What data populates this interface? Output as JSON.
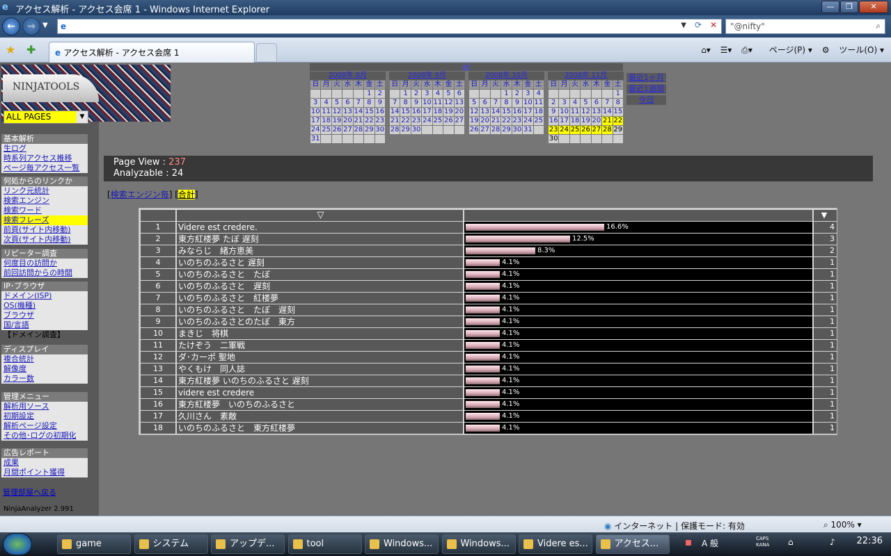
{
  "window": {
    "title": "アクセス解析 - アクセス会席 1 - Windows Internet Explorer"
  },
  "ie_icon": "ie-logo-icon",
  "address": {
    "url": "",
    "search_placeholder": "\"@nifty\""
  },
  "tab": {
    "title": "アクセス解析 - アクセス会席 1"
  },
  "cmd": {
    "page": "ページ(P)",
    "tools": "ツール(O)"
  },
  "logo": {
    "text": "NINJATOOLS"
  },
  "page_select": {
    "value": "ALL PAGES"
  },
  "sidebar": [
    {
      "header": "基本解析",
      "items": [
        {
          "label": "生ログ"
        },
        {
          "label": "時系列アクセス推移"
        },
        {
          "label": "ページ毎アクセス一覧"
        }
      ]
    },
    {
      "header": "何処からのリンクか",
      "items": [
        {
          "label": "リンク元統計"
        },
        {
          "label": "検索エンジン"
        },
        {
          "label": "検索ワード"
        },
        {
          "label": "検索フレーズ",
          "selected": true
        },
        {
          "label": "前頁(サイト内移動)"
        },
        {
          "label": "次頁(サイト内移動)"
        }
      ]
    },
    {
      "header": "リピーター調査",
      "items": [
        {
          "label": "何度目の訪問か"
        },
        {
          "label": "前回訪問からの時間"
        }
      ]
    },
    {
      "header": "IP･ブラウザ",
      "items": [
        {
          "label": "ドメイン(ISP)"
        },
        {
          "label": "OS(機種)"
        },
        {
          "label": "ブラウザ"
        },
        {
          "label": "国/言語"
        },
        {
          "label": "【ドメイン調査】",
          "plain": true
        }
      ]
    },
    {
      "header": "ディスプレイ",
      "items": [
        {
          "label": "複合統計"
        },
        {
          "label": "解像度"
        },
        {
          "label": "カラー数"
        }
      ]
    },
    {
      "header": "管理メニュー",
      "items": [
        {
          "label": "解析用ソース"
        },
        {
          "label": "初期設定"
        },
        {
          "label": "解析ページ設定"
        },
        {
          "label": "その他･ログの初期化"
        }
      ]
    },
    {
      "header": "広告レポート",
      "items": [
        {
          "label": "成果"
        },
        {
          "label": "月間ポイント獲得"
        }
      ]
    }
  ],
  "admin_link": "管理部屋へ戻る",
  "version": "NinjaAnalyzer 2.991",
  "calendar": {
    "all_label": "all",
    "weekdays": [
      "日",
      "月",
      "火",
      "水",
      "木",
      "金",
      "土"
    ],
    "months": [
      {
        "label": "2008年 8月",
        "weeks": [
          [
            "",
            "",
            "",
            "",
            "",
            "1",
            "2"
          ],
          [
            "3",
            "4",
            "5",
            "6",
            "7",
            "8",
            "9"
          ],
          [
            "10",
            "11",
            "12",
            "13",
            "14",
            "15",
            "16"
          ],
          [
            "17",
            "18",
            "19",
            "20",
            "21",
            "22",
            "23"
          ],
          [
            "24",
            "25",
            "26",
            "27",
            "28",
            "29",
            "30"
          ],
          [
            "31",
            "",
            "",
            "",
            "",
            "",
            ""
          ]
        ]
      },
      {
        "label": "2008年 9月",
        "weeks": [
          [
            "",
            "1",
            "2",
            "3",
            "4",
            "5",
            "6"
          ],
          [
            "7",
            "8",
            "9",
            "10",
            "11",
            "12",
            "13"
          ],
          [
            "14",
            "15",
            "16",
            "17",
            "18",
            "19",
            "20"
          ],
          [
            "21",
            "22",
            "23",
            "24",
            "25",
            "26",
            "27"
          ],
          [
            "28",
            "29",
            "30",
            "",
            "",
            "",
            ""
          ]
        ]
      },
      {
        "label": "2008年 10月",
        "weeks": [
          [
            "",
            "",
            "",
            "1",
            "2",
            "3",
            "4"
          ],
          [
            "5",
            "6",
            "7",
            "8",
            "9",
            "10",
            "11"
          ],
          [
            "12",
            "13",
            "14",
            "15",
            "16",
            "17",
            "18"
          ],
          [
            "19",
            "20",
            "21",
            "22",
            "23",
            "24",
            "25"
          ],
          [
            "26",
            "27",
            "28",
            "29",
            "30",
            "31",
            ""
          ]
        ]
      },
      {
        "label": "2008年 11月",
        "weeks": [
          [
            "",
            "",
            "",
            "",
            "",
            "",
            "1"
          ],
          [
            "2",
            "3",
            "4",
            "5",
            "6",
            "7",
            "8"
          ],
          [
            "9",
            "10",
            "11",
            "12",
            "13",
            "14",
            "15"
          ],
          [
            "16",
            "17",
            "18",
            "19",
            "20",
            "21",
            "22"
          ],
          [
            "23",
            "24",
            "25",
            "26",
            "27",
            "28",
            "29"
          ],
          [
            "30",
            "",
            "",
            "",
            "",
            "",
            ""
          ]
        ]
      }
    ],
    "highlight_november": [
      "21",
      "22",
      "23",
      "24",
      "25",
      "26",
      "27",
      "28"
    ],
    "range_buttons": [
      "最近1ヶ月",
      "最近1週間",
      "今日"
    ]
  },
  "summary": {
    "page_view_label": "Page View : ",
    "page_view_value": "237",
    "analyzable_label": "Analyzable : ",
    "analyzable_value": "24"
  },
  "subtabs": {
    "left_bracket": "[",
    "engine": "検索エンジン毎",
    "mid": "] [",
    "total": "合計",
    "right_bracket": "]"
  },
  "table": {
    "header_term": "▽",
    "header_count": "▼",
    "rows": [
      {
        "n": "1",
        "term": "Videre est credere.",
        "pct": "16.6%",
        "ratio": 0.166,
        "count": "4"
      },
      {
        "n": "2",
        "term": "東方紅楼夢 たぼ 遅刻",
        "pct": "12.5%",
        "ratio": 0.125,
        "count": "3"
      },
      {
        "n": "3",
        "term": "みならじ　緒方恵美",
        "pct": "8.3%",
        "ratio": 0.083,
        "count": "2"
      },
      {
        "n": "4",
        "term": "いのちのふるさと 遅刻",
        "pct": "4.1%",
        "ratio": 0.041,
        "count": "1"
      },
      {
        "n": "5",
        "term": "いのちのふるさと　たぼ",
        "pct": "4.1%",
        "ratio": 0.041,
        "count": "1"
      },
      {
        "n": "6",
        "term": "いのちのふるさと　遅刻",
        "pct": "4.1%",
        "ratio": 0.041,
        "count": "1"
      },
      {
        "n": "7",
        "term": "いのちのふるさと　紅楼夢",
        "pct": "4.1%",
        "ratio": 0.041,
        "count": "1"
      },
      {
        "n": "8",
        "term": "いのちのふるさと　たぼ　遅刻",
        "pct": "4.1%",
        "ratio": 0.041,
        "count": "1"
      },
      {
        "n": "9",
        "term": "いのちのふるさとのたぼ　東方",
        "pct": "4.1%",
        "ratio": 0.041,
        "count": "1"
      },
      {
        "n": "10",
        "term": "まきじ　将棋",
        "pct": "4.1%",
        "ratio": 0.041,
        "count": "1"
      },
      {
        "n": "11",
        "term": "たけぞう　二軍戦",
        "pct": "4.1%",
        "ratio": 0.041,
        "count": "1"
      },
      {
        "n": "12",
        "term": "ダ･カーポ 聖地",
        "pct": "4.1%",
        "ratio": 0.041,
        "count": "1"
      },
      {
        "n": "13",
        "term": "やくもけ　同人誌",
        "pct": "4.1%",
        "ratio": 0.041,
        "count": "1"
      },
      {
        "n": "14",
        "term": "東方紅楼夢 いのちのふるさと 遅刻",
        "pct": "4.1%",
        "ratio": 0.041,
        "count": "1"
      },
      {
        "n": "15",
        "term": "videre est credere",
        "pct": "4.1%",
        "ratio": 0.041,
        "count": "1"
      },
      {
        "n": "16",
        "term": "東方紅楼夢　いのちのふるさと",
        "pct": "4.1%",
        "ratio": 0.041,
        "count": "1"
      },
      {
        "n": "17",
        "term": "久川さん　素敵",
        "pct": "4.1%",
        "ratio": 0.041,
        "count": "1"
      },
      {
        "n": "18",
        "term": "いのちのふるさと　東方紅楼夢",
        "pct": "4.1%",
        "ratio": 0.041,
        "count": "1"
      }
    ]
  },
  "statusbar": {
    "zone": "インターネット | 保護モード: 有効",
    "zoom": "100%"
  },
  "taskbar": {
    "items": [
      {
        "label": "game"
      },
      {
        "label": "システム"
      },
      {
        "label": "アップデ..."
      },
      {
        "label": "tool"
      },
      {
        "label": "Windows..."
      },
      {
        "label": "Windows..."
      },
      {
        "label": "Videre es..."
      },
      {
        "label": "アクセス...",
        "active": true
      }
    ],
    "tray_ime": "A 般",
    "tray_caps": "CAPS KANA",
    "clock": "22:36"
  }
}
